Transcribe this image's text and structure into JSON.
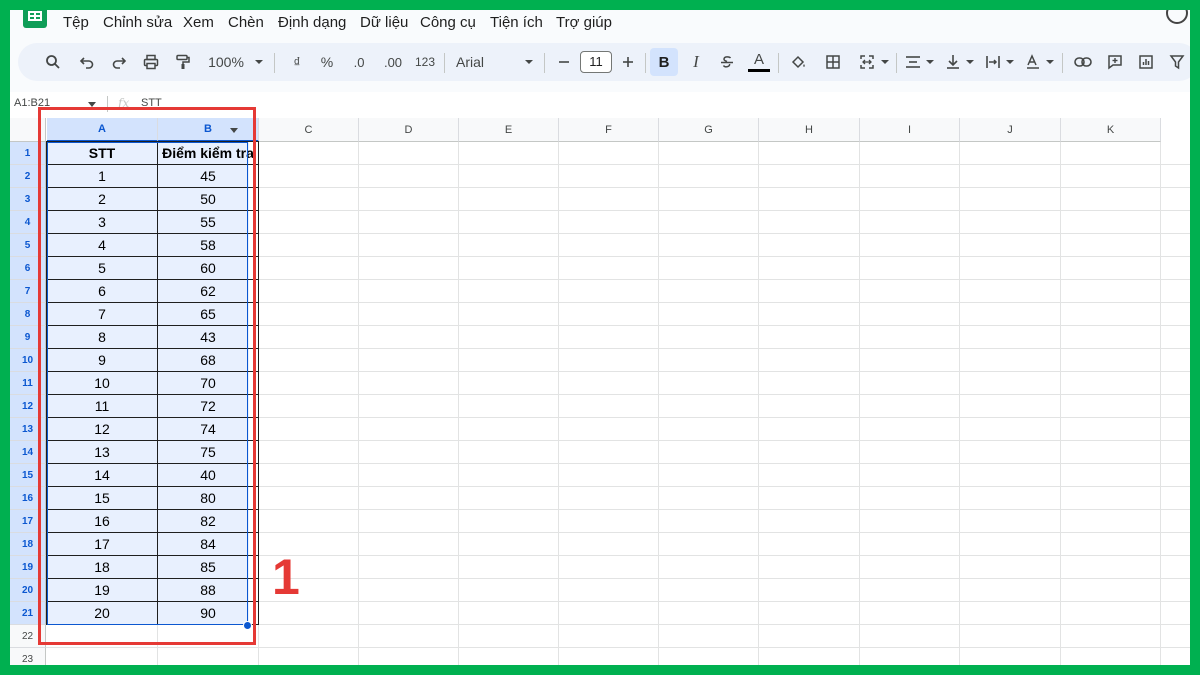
{
  "menu": {
    "items": [
      "Tệp",
      "Chỉnh sửa",
      "Xem",
      "Chèn",
      "Định dạng",
      "Dữ liệu",
      "Công cụ",
      "Tiện ích",
      "Trợ giúp"
    ]
  },
  "toolbar": {
    "zoom": "100%",
    "currency": "₫",
    "percent": "%",
    "decrease_decimal": ".0",
    "increase_decimal": ".00",
    "format_123": "123",
    "font_name": "Arial",
    "font_size": "11",
    "bold": "B",
    "italic": "I",
    "text_color": "A"
  },
  "formula_bar": {
    "name_box": "A1:B21",
    "fx": "fx",
    "value": "STT"
  },
  "sheet": {
    "columns": [
      "A",
      "B",
      "C",
      "D",
      "E",
      "F",
      "G",
      "H",
      "I",
      "J",
      "K"
    ],
    "rows": [
      "1",
      "2",
      "3",
      "4",
      "5",
      "6",
      "7",
      "8",
      "9",
      "10",
      "11",
      "12",
      "13",
      "14",
      "15",
      "16",
      "17",
      "18",
      "19",
      "20",
      "21",
      "22",
      "23"
    ],
    "table": {
      "headers": [
        "STT",
        "Điểm kiểm tra"
      ],
      "stt": [
        "1",
        "2",
        "3",
        "4",
        "5",
        "6",
        "7",
        "8",
        "9",
        "10",
        "11",
        "12",
        "13",
        "14",
        "15",
        "16",
        "17",
        "18",
        "19",
        "20"
      ],
      "scores": [
        "45",
        "50",
        "55",
        "58",
        "60",
        "62",
        "65",
        "43",
        "68",
        "70",
        "72",
        "74",
        "75",
        "40",
        "80",
        "82",
        "84",
        "85",
        "88",
        "90"
      ]
    }
  },
  "annotation": {
    "label": "1",
    "color": "#e53935"
  },
  "colors": {
    "frame": "#00b050",
    "selection": "#e8f0fe",
    "accent": "#0b57d0"
  }
}
